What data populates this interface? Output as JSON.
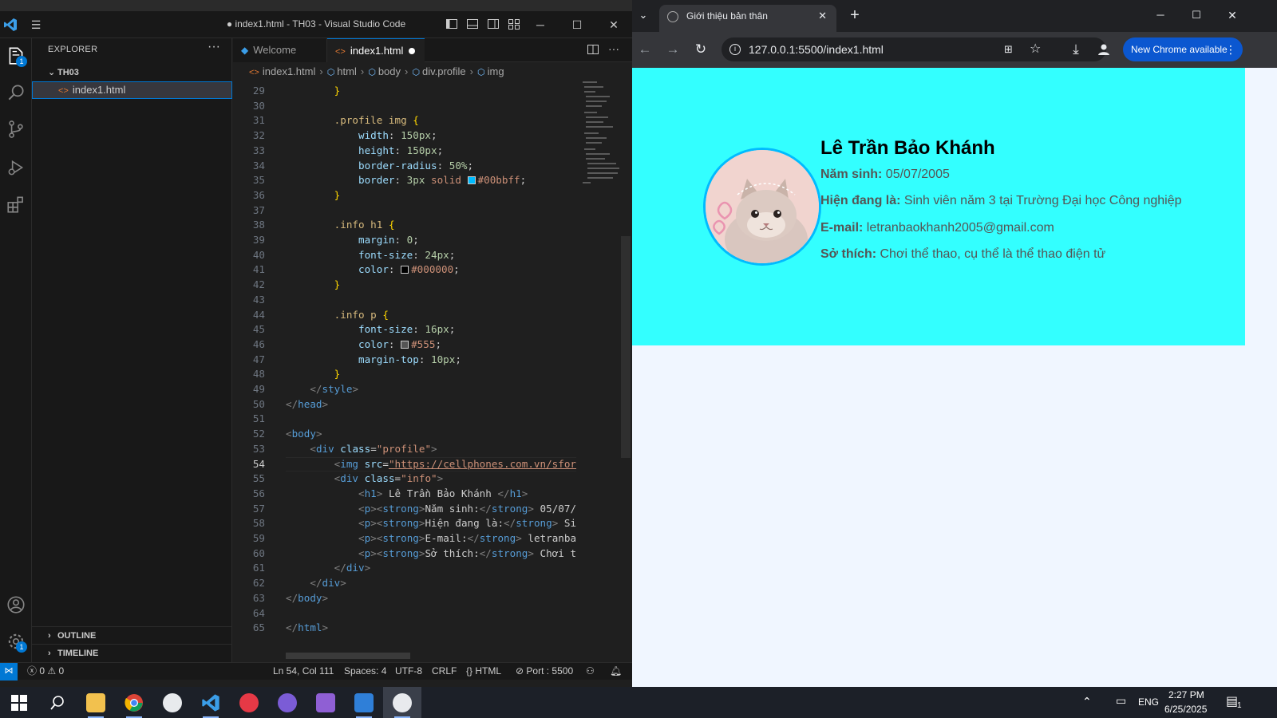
{
  "vscode": {
    "title": "● index1.html - TH03 - Visual Studio Code",
    "activity_badges": {
      "explorer": "1",
      "settings": "1"
    },
    "sidebar": {
      "header": "EXPLORER",
      "folder": "TH03",
      "file": "index1.html",
      "outline": "OUTLINE",
      "timeline": "TIMELINE"
    },
    "tabs": [
      {
        "label": "Welcome",
        "active": false
      },
      {
        "label": "index1.html",
        "active": true,
        "modified": true
      }
    ],
    "breadcrumb": [
      "index1.html",
      "html",
      "body",
      "div.profile",
      "img"
    ],
    "status": {
      "errors": "0",
      "warnings": "0",
      "position": "Ln 54, Col 111",
      "spaces": "Spaces: 4",
      "encoding": "UTF-8",
      "eol": "CRLF",
      "language": "HTML",
      "port": "Port : 5500"
    },
    "current_line": "54"
  },
  "chrome": {
    "tab_title": "Giới thiệu bản thân",
    "url": "127.0.0.1:5500/index1.html",
    "new_chrome": "New Chrome available",
    "page": {
      "name": "Lê Trần Bảo Khánh",
      "rows": [
        {
          "label": "Năm sinh:",
          "value": "05/07/2005"
        },
        {
          "label": "Hiện đang là:",
          "value": "Sinh viên năm 3 tại Trường Đại học Công nghiệp"
        },
        {
          "label": "E-mail:",
          "value": "letranbaokhanh2005@gmail.com"
        },
        {
          "label": "Sở thích:",
          "value": "Chơi thể thao, cụ thể là thể thao điện tử"
        }
      ]
    }
  },
  "taskbar": {
    "lang": "ENG",
    "time": "2:27 PM",
    "date": "6/25/2025",
    "notif_count": "1"
  }
}
